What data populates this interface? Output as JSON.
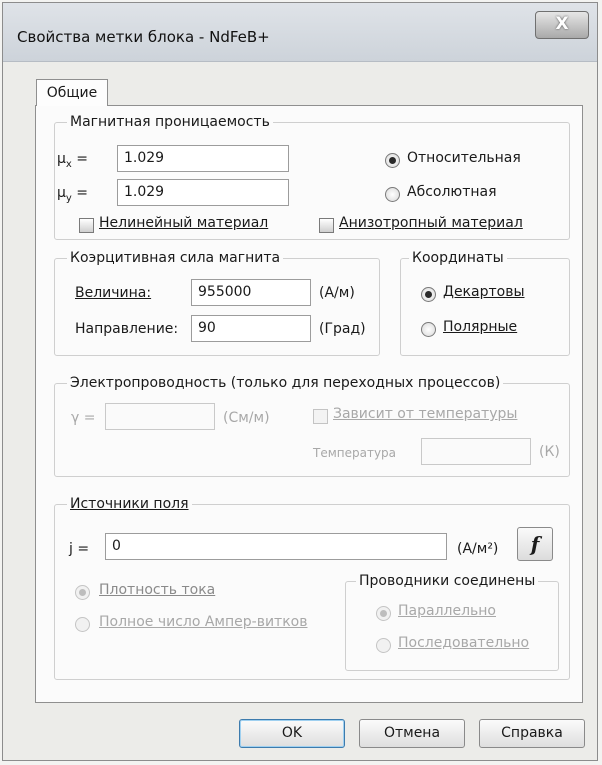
{
  "window": {
    "title": "Свойства метки блока - NdFeB+"
  },
  "title_controls": {
    "close": "X"
  },
  "tabs": [
    {
      "label": "Общие"
    }
  ],
  "permeability": {
    "legend": "Магнитная проницаемость",
    "mu_x_label": "μx =",
    "mu_x_value": "1.029",
    "mu_y_label": "μy =",
    "mu_y_value": "1.029",
    "relative_label": "Относительная",
    "absolute_label": "Абсолютная",
    "selected": "relative",
    "nonlinear_label": "Нелинейный материал",
    "nonlinear_checked": false,
    "anisotropic_label": "Анизотропный материал",
    "anisotropic_checked": false
  },
  "coercive": {
    "legend": "Коэрцитивная сила магнита",
    "magnitude_label": "Величина:",
    "magnitude_value": "955000",
    "magnitude_unit": "(А/м)",
    "direction_label": "Направление:",
    "direction_value": "90",
    "direction_unit": "(Град)"
  },
  "coordinates": {
    "legend": "Координаты",
    "cartesian_label": "Декартовы",
    "polar_label": "Полярные",
    "selected": "cartesian"
  },
  "conductivity": {
    "legend": "Электропроводность (только для переходных процессов)",
    "gamma_label": "γ =",
    "gamma_value": "",
    "gamma_unit": "(См/м)",
    "temp_dependent_label": "Зависит от температуры",
    "temp_dependent_checked": false,
    "temperature_label": "Температура",
    "temperature_value": "",
    "temperature_unit": "(К)"
  },
  "sources": {
    "legend": "Источники поля",
    "j_label": "j =",
    "j_value": "0",
    "j_unit": "(А/м²)",
    "f_button": "f",
    "density_label": "Плотность тока",
    "total_label": "Полное число Ампер-витков",
    "selected": "density",
    "conductors": {
      "legend": "Проводники соединены",
      "parallel_label": "Параллельно",
      "series_label": "Последовательно",
      "selected": "parallel"
    }
  },
  "buttons": {
    "ok": "OK",
    "cancel": "Отмена",
    "help": "Справка"
  }
}
